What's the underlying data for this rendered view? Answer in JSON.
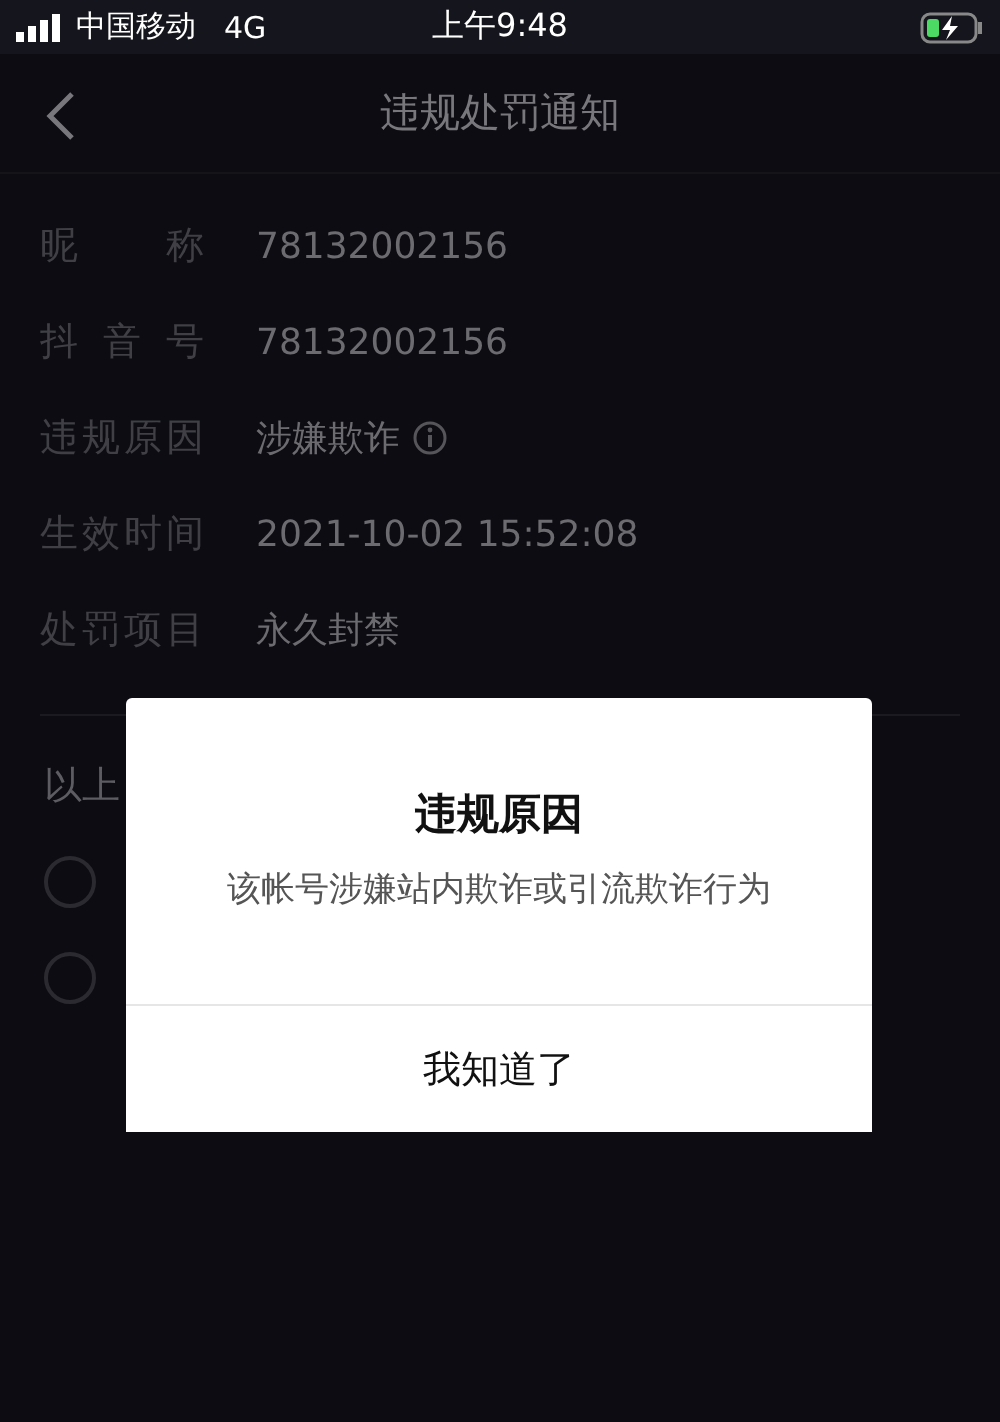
{
  "status_bar": {
    "carrier": "中国移动",
    "network": "4G",
    "time": "上午9:48"
  },
  "nav": {
    "title": "违规处罚通知"
  },
  "details": [
    {
      "label": "昵称",
      "value": "78132002156",
      "info": false
    },
    {
      "label": "抖音号",
      "value": "78132002156",
      "info": false
    },
    {
      "label": "违规原因",
      "value": "涉嫌欺诈",
      "info": true
    },
    {
      "label": "生效时间",
      "value": "2021-10-02 15:52:08",
      "info": false
    },
    {
      "label": "处罚项目",
      "value": "永久封禁",
      "info": false
    }
  ],
  "section": {
    "heading": "以上",
    "options": [
      {
        "selected": false
      },
      {
        "selected": false
      }
    ]
  },
  "dialog": {
    "title": "违规原因",
    "message": "该帐号涉嫌站内欺诈或引流欺诈行为",
    "button": "我知道了"
  }
}
